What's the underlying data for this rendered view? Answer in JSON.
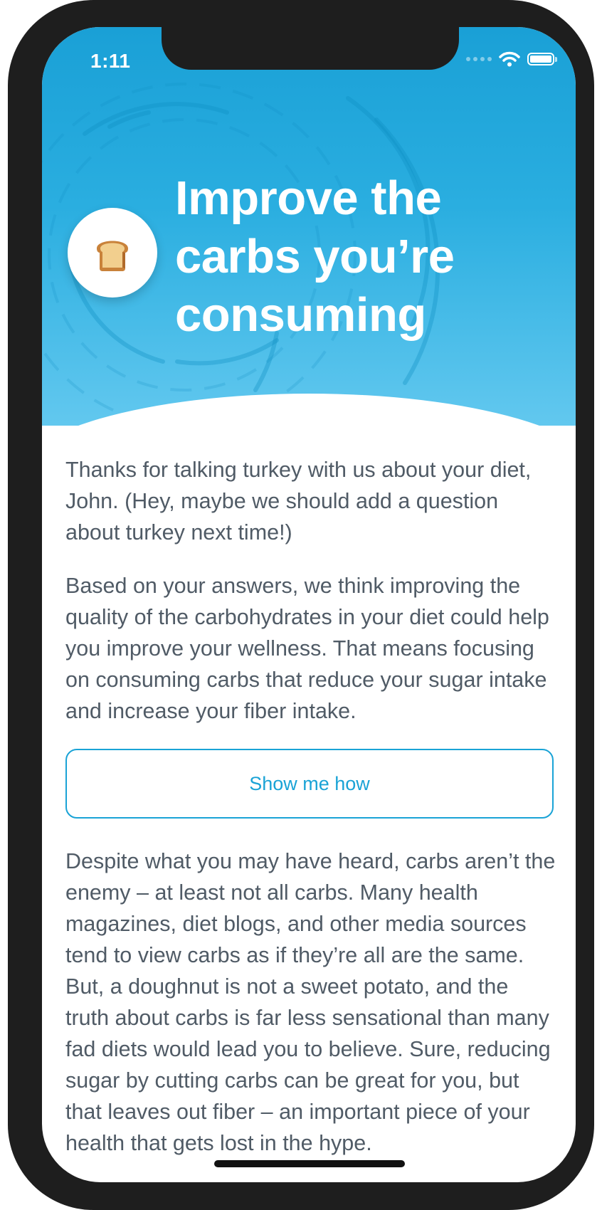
{
  "status_bar": {
    "time": "1:11"
  },
  "hero": {
    "title": "Improve the carbs you’re consuming",
    "icon": "bread-emoji"
  },
  "content": {
    "paragraph_1": "Thanks for talking turkey with us about your diet, John. (Hey, maybe we should add a question about turkey next time!)",
    "paragraph_2": "Based on your answers, we think improving the quality of the carbohydrates in your diet could help you improve your wellness. That means focusing on consuming carbs that reduce your sugar intake and increase your fiber intake.",
    "cta_label": "Show me how",
    "paragraph_3": "Despite what you may have heard, carbs aren’t the enemy – at least not all carbs. Many health magazines, diet blogs, and other media sources tend to view carbs as if they’re all are the same. But, a doughnut is not a sweet potato, and the truth about carbs is far less sensational than many fad diets would lead you to believe. Sure, reducing sugar by cutting carbs can be great for you, but that leaves out fiber – an important piece of your health that gets lost in the hype."
  },
  "colors": {
    "accent": "#1aa3d6",
    "hero_top": "#1aa0d6",
    "hero_bottom": "#62c8ef",
    "body_text": "#505b66"
  }
}
